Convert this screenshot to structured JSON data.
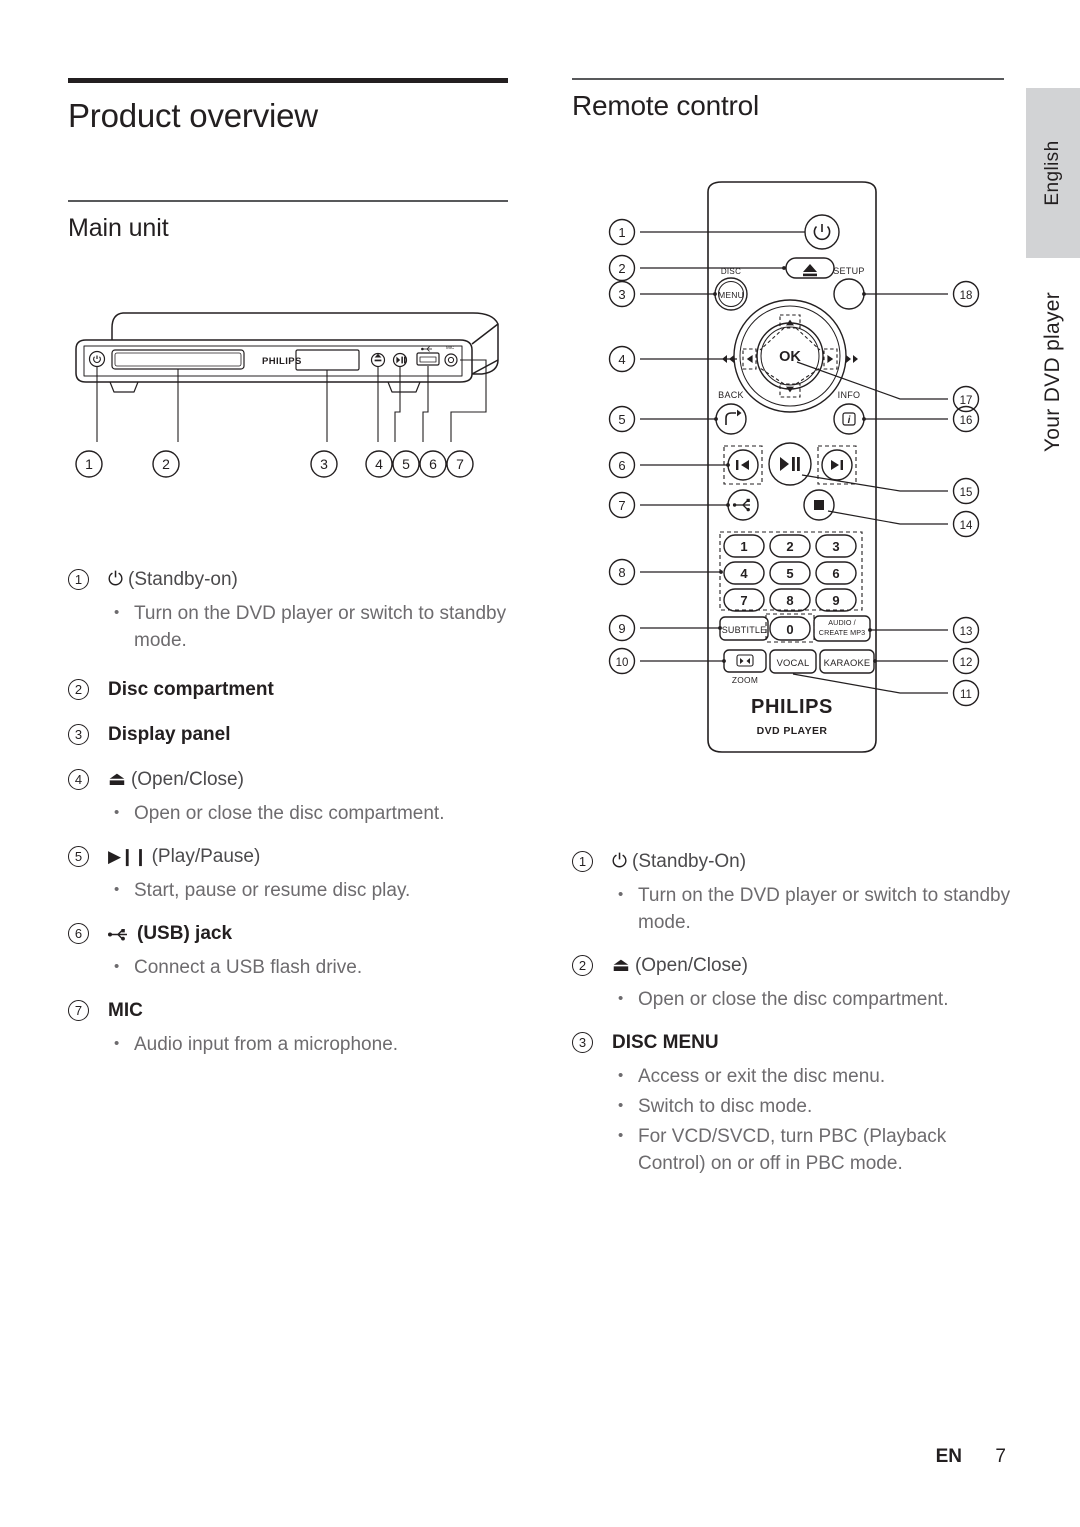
{
  "sidebar": {
    "language_tab": "English",
    "chapter_label": "Your DVD player"
  },
  "left_column": {
    "section_title": "Product overview",
    "sub_title": "Main unit",
    "figure": {
      "name": "main-unit-front-panel",
      "brand": "PHILIPS",
      "callouts": [
        "1",
        "2",
        "3",
        "4",
        "5",
        "6",
        "7"
      ]
    },
    "items": [
      {
        "num": "1",
        "glyph": "standby-power-icon",
        "title": "(Standby-on)",
        "bold": false,
        "bullets": [
          "Turn on the DVD player or switch to standby mode."
        ]
      },
      {
        "num": "2",
        "glyph": "",
        "title": "Disc compartment",
        "bold": true,
        "bullets": []
      },
      {
        "num": "3",
        "glyph": "",
        "title": "Display panel",
        "bold": true,
        "bullets": []
      },
      {
        "num": "4",
        "glyph": "eject-icon",
        "title": "(Open/Close)",
        "bold": false,
        "bullets": [
          "Open or close the disc compartment."
        ]
      },
      {
        "num": "5",
        "glyph": "play-pause-icon",
        "title": "(Play/Pause)",
        "bold": false,
        "bullets": [
          "Start, pause or resume disc play."
        ]
      },
      {
        "num": "6",
        "glyph": "usb-icon",
        "title": "(USB) jack",
        "bold": true,
        "bullets": [
          "Connect a USB flash drive."
        ]
      },
      {
        "num": "7",
        "glyph": "",
        "title": "MIC",
        "bold": true,
        "bullets": [
          "Audio input from a microphone."
        ]
      }
    ]
  },
  "right_column": {
    "section_title": "Remote control",
    "figure": {
      "name": "remote-control",
      "brand": "PHILIPS",
      "brand_sub": "DVD PLAYER",
      "buttons": {
        "disc_menu": [
          "DISC",
          "MENU"
        ],
        "setup": "SETUP",
        "ok": "OK",
        "back": "BACK",
        "info": "INFO",
        "keypad": [
          "1",
          "2",
          "3",
          "4",
          "5",
          "6",
          "7",
          "8",
          "9"
        ],
        "zero": "0",
        "subtitle": "SUBTITLE",
        "audio_create_mp3": [
          "AUDIO /",
          "CREATE MP3"
        ],
        "zoom": "ZOOM",
        "vocal": "VOCAL",
        "karaoke": "KARAOKE"
      },
      "callouts_left": [
        "1",
        "2",
        "3",
        "4",
        "5",
        "6",
        "7",
        "8",
        "9",
        "10"
      ],
      "callouts_right": [
        "18",
        "17",
        "16",
        "15",
        "14",
        "13",
        "12",
        "11"
      ]
    },
    "items": [
      {
        "num": "1",
        "glyph": "standby-power-icon",
        "title": "(Standby-On)",
        "bold": false,
        "bullets": [
          "Turn on the DVD player or switch to standby mode."
        ]
      },
      {
        "num": "2",
        "glyph": "eject-icon",
        "title": "(Open/Close)",
        "bold": false,
        "bullets": [
          "Open or close the disc compartment."
        ]
      },
      {
        "num": "3",
        "glyph": "",
        "title": "DISC MENU",
        "bold": true,
        "bullets": [
          "Access or exit the disc menu.",
          "Switch to disc mode.",
          "For VCD/SVCD, turn PBC (Playback Control) on or off in PBC mode."
        ]
      }
    ]
  },
  "footer": {
    "language_code": "EN",
    "page_number": "7"
  }
}
